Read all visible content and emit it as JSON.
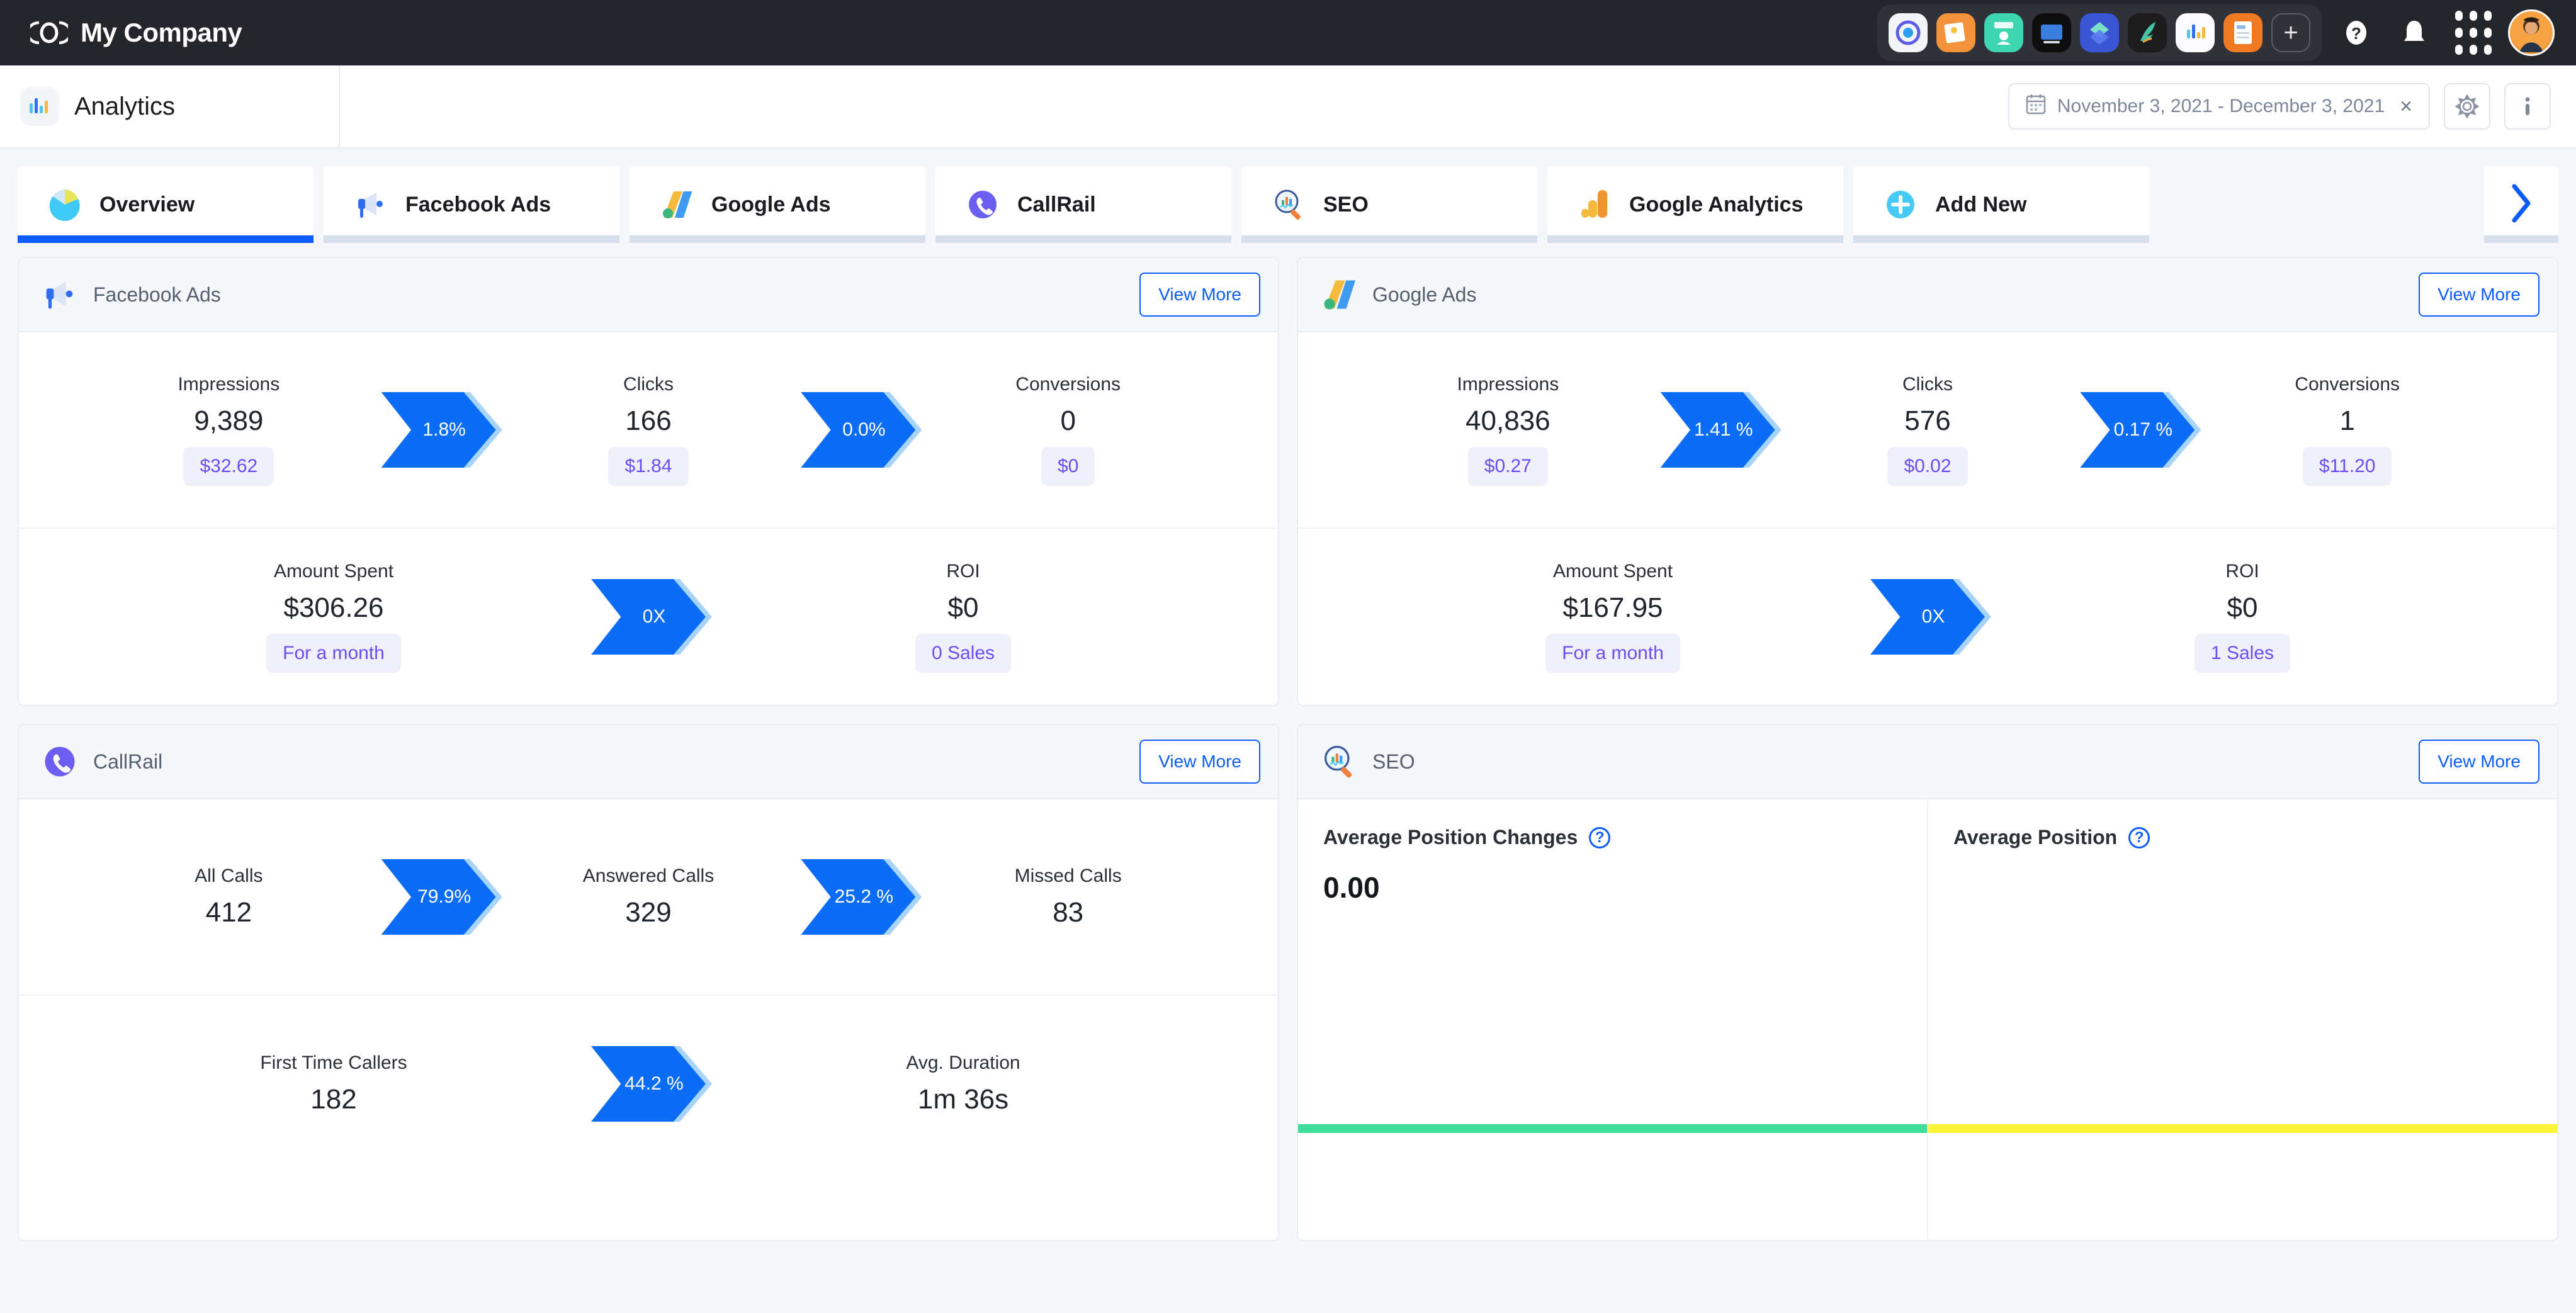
{
  "topbar": {
    "brand": "My Company",
    "logo_icon": "company-logo-icon",
    "apps": [
      {
        "name": "app-icon-target",
        "bg": "#ffffff"
      },
      {
        "name": "app-icon-photos",
        "bg": "#f2933c"
      },
      {
        "name": "app-icon-contacts",
        "bg": "#3dd6b0"
      },
      {
        "name": "app-icon-device",
        "bg": "#0d0d0d"
      },
      {
        "name": "app-icon-layers",
        "bg": "#3a56d4"
      },
      {
        "name": "app-icon-hummingbird",
        "bg": "#1c1c1c"
      },
      {
        "name": "app-icon-analytics",
        "bg": "#ffffff"
      },
      {
        "name": "app-icon-invoices",
        "bg": "#f07a22"
      },
      {
        "name": "app-icon-add",
        "bg": "transparent"
      }
    ],
    "help_label": "?",
    "help_icon": "question-mark-icon",
    "bell_icon": "notification-bell-icon",
    "grid_icon": "app-grid-icon",
    "avatar_icon": "user-avatar"
  },
  "subheader": {
    "page_icon": "analytics-icon",
    "page_title": "Analytics",
    "date_range": "November 3, 2021 - December 3, 2021",
    "date_icon": "calendar-icon",
    "clear_icon": "×",
    "settings_icon": "gear-icon",
    "info_icon": "info-icon"
  },
  "tabs": [
    {
      "label": "Overview",
      "icon": "pie-chart-icon",
      "active": true
    },
    {
      "label": "Facebook Ads",
      "icon": "megaphone-icon",
      "active": false
    },
    {
      "label": "Google Ads",
      "icon": "google-ads-icon",
      "active": false
    },
    {
      "label": "CallRail",
      "icon": "phone-icon",
      "active": false
    },
    {
      "label": "SEO",
      "icon": "magnifier-icon",
      "active": false
    },
    {
      "label": "Google Analytics",
      "icon": "google-analytics-icon",
      "active": false
    },
    {
      "label": "Add New",
      "icon": "plus-circle-icon",
      "active": false
    }
  ],
  "tab_next_icon": "chevron-right-icon",
  "cards": {
    "facebook_ads": {
      "title": "Facebook Ads",
      "icon": "megaphone-icon",
      "view_more": "View More",
      "row1": [
        {
          "label": "Impressions",
          "value": "9,389",
          "pill": "$32.62"
        },
        {
          "label": "Clicks",
          "value": "166",
          "pill": "$1.84"
        },
        {
          "label": "Conversions",
          "value": "0",
          "pill": "$0"
        }
      ],
      "row1_badges": [
        "1.8%",
        "0.0%"
      ],
      "row2": [
        {
          "label": "Amount Spent",
          "value": "$306.26",
          "pill": "For a month"
        },
        {
          "label": "ROI",
          "value": "$0",
          "pill": "0 Sales"
        }
      ],
      "row2_badges": [
        "0X"
      ]
    },
    "google_ads": {
      "title": "Google Ads",
      "icon": "google-ads-icon",
      "view_more": "View More",
      "row1": [
        {
          "label": "Impressions",
          "value": "40,836",
          "pill": "$0.27"
        },
        {
          "label": "Clicks",
          "value": "576",
          "pill": "$0.02"
        },
        {
          "label": "Conversions",
          "value": "1",
          "pill": "$11.20"
        }
      ],
      "row1_badges": [
        "1.41 %",
        "0.17 %"
      ],
      "row2": [
        {
          "label": "Amount Spent",
          "value": "$167.95",
          "pill": "For a month"
        },
        {
          "label": "ROI",
          "value": "$0",
          "pill": "1 Sales"
        }
      ],
      "row2_badges": [
        "0X"
      ]
    },
    "callrail": {
      "title": "CallRail",
      "icon": "phone-icon",
      "view_more": "View More",
      "row1": [
        {
          "label": "All Calls",
          "value": "412"
        },
        {
          "label": "Answered Calls",
          "value": "329"
        },
        {
          "label": "Missed Calls",
          "value": "83"
        }
      ],
      "row1_badges": [
        "79.9%",
        "25.2 %"
      ],
      "row2": [
        {
          "label": "First Time Callers",
          "value": "182"
        },
        {
          "label": "Avg. Duration",
          "value": "1m 36s"
        }
      ],
      "row2_badges": [
        "44.2 %"
      ]
    },
    "seo": {
      "title": "SEO",
      "icon": "magnifier-icon",
      "view_more": "View More",
      "panels": [
        {
          "title": "Average Position Changes",
          "value": "0.00",
          "bar_color": "#3ddc97",
          "help": "?"
        },
        {
          "title": "Average Position",
          "value": "",
          "bar_color": "#fbf436",
          "help": "?"
        }
      ]
    }
  },
  "colors": {
    "accent_blue": "#0b5cff",
    "badge_blue": "#0b6cf5",
    "badge_shadow": "#a8d4fb",
    "pill_purple": "#6a4df5",
    "topbar_dark": "#25262b",
    "page_bg": "#f5f7fb"
  }
}
